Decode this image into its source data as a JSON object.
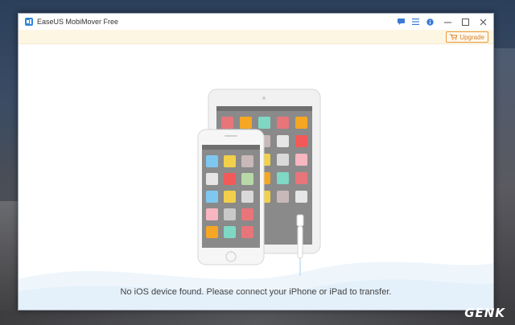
{
  "window": {
    "title": "EaseUS MobiMover Free",
    "controls": [
      {
        "name": "feedback-icon",
        "glyph": "💬"
      },
      {
        "name": "menu-icon",
        "glyph": "☰"
      },
      {
        "name": "info-icon",
        "glyph": "ⓘ"
      },
      {
        "name": "minimize-icon",
        "glyph": "—"
      },
      {
        "name": "maximize-icon",
        "glyph": "□"
      },
      {
        "name": "close-icon",
        "glyph": "✕"
      }
    ]
  },
  "upgrade": {
    "label": "Upgrade"
  },
  "main": {
    "status": "No iOS device found. Please connect your iPhone or iPad to transfer."
  },
  "watermark": {
    "text": "GENK"
  },
  "colors": {
    "accent": "#2e86de",
    "upgrade_border": "#e89a3c",
    "app_tiles": [
      "#e8757a",
      "#f5a623",
      "#7ed8c4",
      "#e8757a",
      "#f5a623",
      "#7ec8f0",
      "#f2d04b",
      "#c9b8b8",
      "#e6e6e6",
      "#f25a5a",
      "#b7d9a8",
      "#7ec8f0",
      "#f2d04b",
      "#d9d9d9",
      "#f7b6c0",
      "#c9c9c9"
    ]
  }
}
